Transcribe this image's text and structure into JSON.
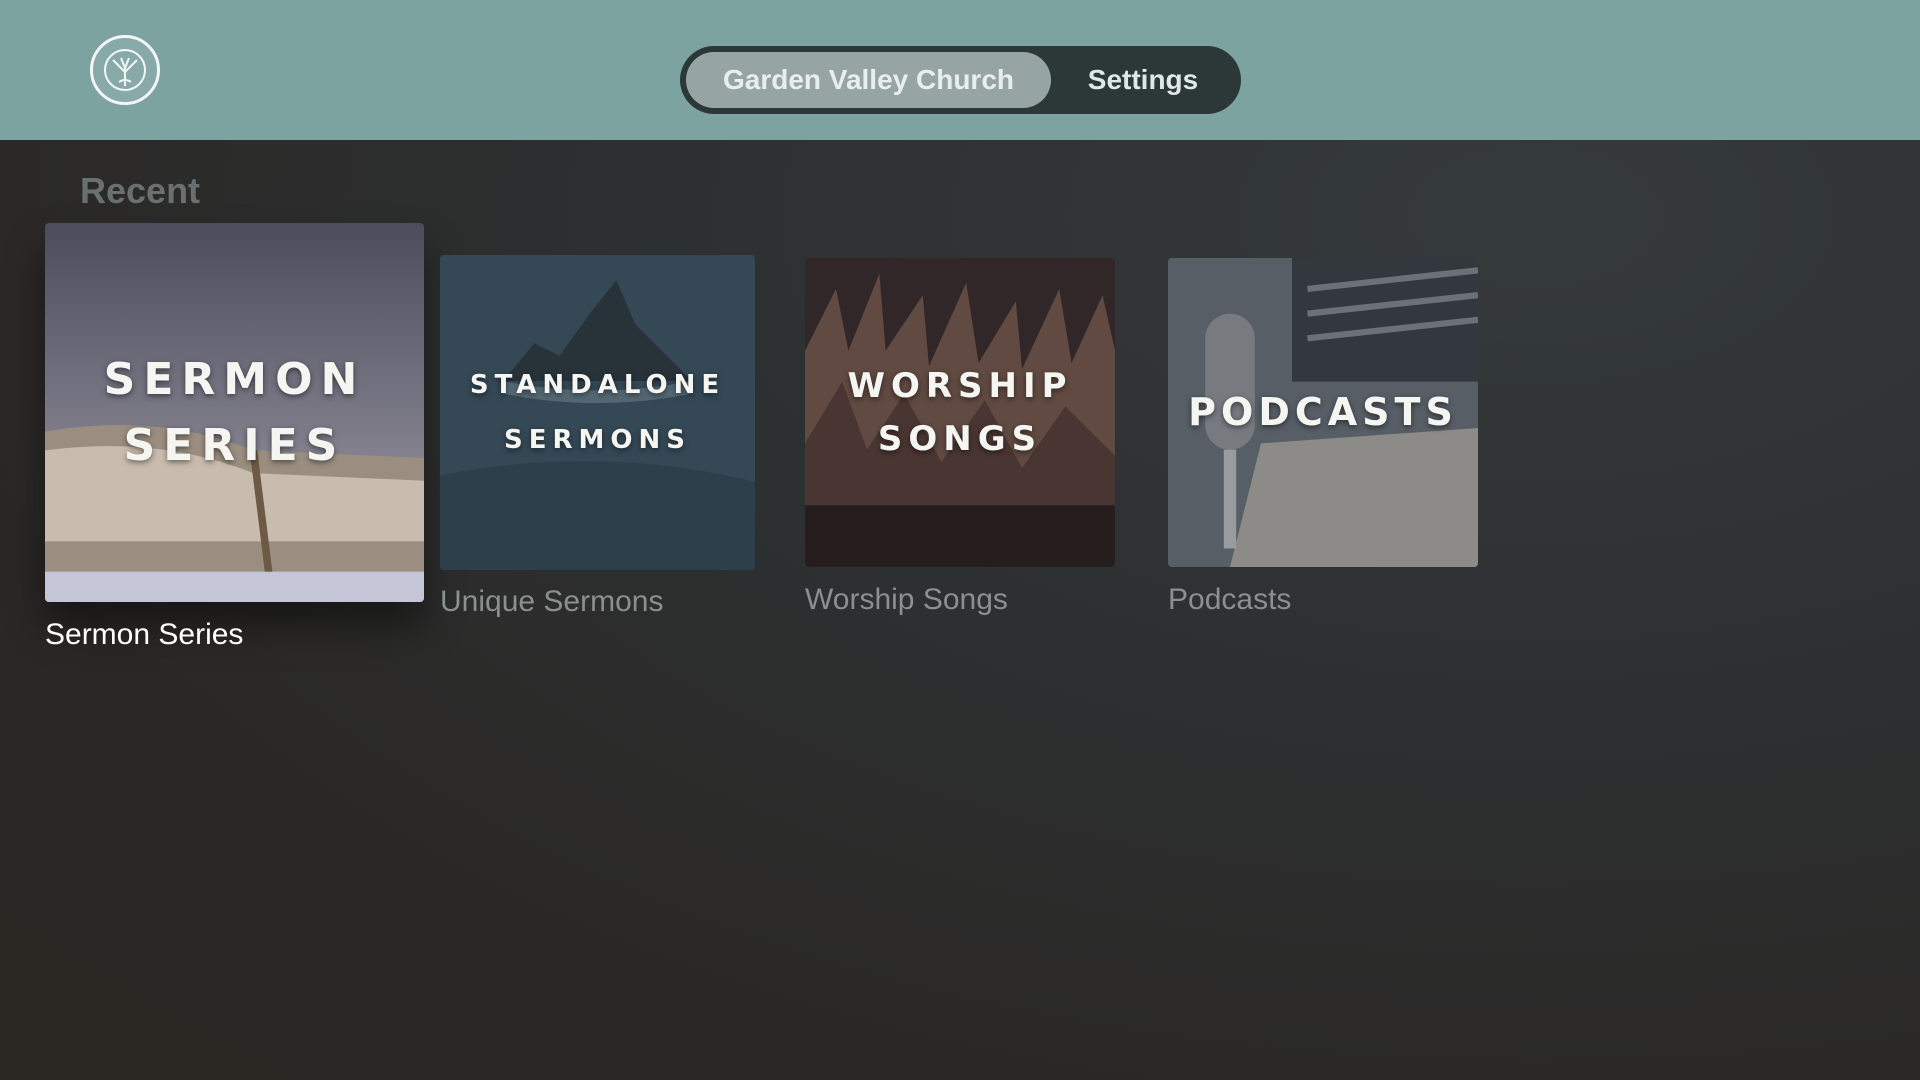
{
  "header": {
    "logo_icon": "garden-valley-church-logo",
    "tabs": [
      {
        "label": "Garden Valley Church",
        "selected": true
      },
      {
        "label": "Settings",
        "selected": false
      }
    ]
  },
  "section": {
    "title": "Recent"
  },
  "cards": [
    {
      "art_title_line1": "SERMON",
      "art_title_line2": "SERIES",
      "label": "Sermon Series",
      "focused": true
    },
    {
      "art_title_line1": "STANDALONE",
      "art_title_line2": "SERMONS",
      "label": "Unique Sermons",
      "focused": false
    },
    {
      "art_title_line1": "WORSHIP",
      "art_title_line2": "SONGS",
      "label": "Worship Songs",
      "focused": false
    },
    {
      "art_title_line1": "PODCASTS",
      "label": "Podcasts",
      "focused": false
    }
  ],
  "colors": {
    "header_bg": "#7da3a1",
    "tab_bar_bg": "#2c3838",
    "tab_selected_bg": "#96a5a4",
    "background": "#2d3031"
  }
}
